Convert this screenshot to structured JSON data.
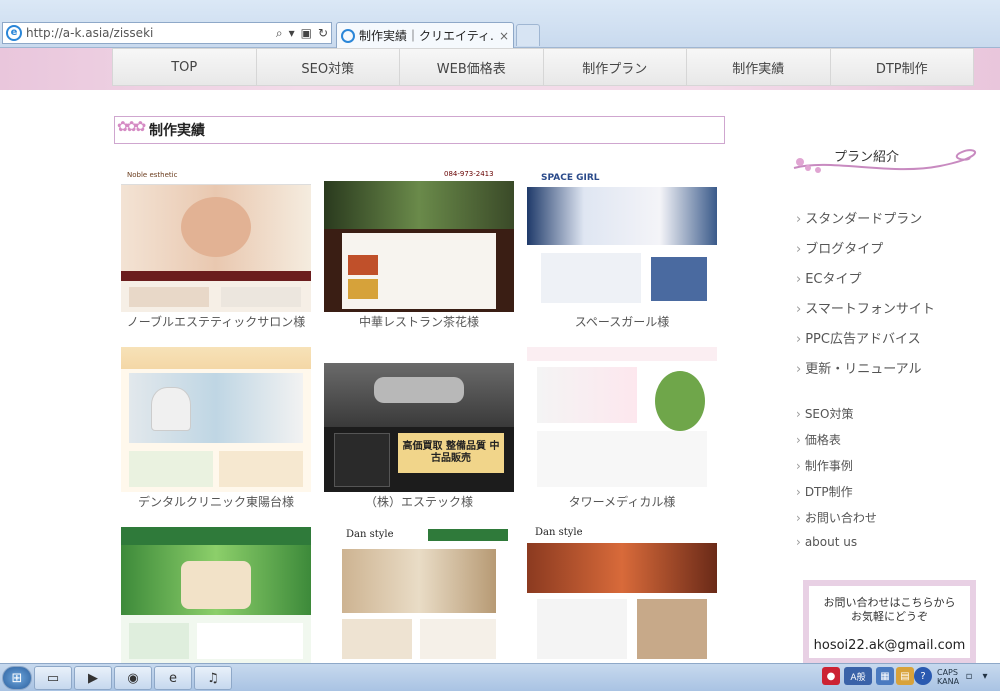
{
  "browser": {
    "address_url": "http://a-k.asia/zisseki",
    "tab_title": "制作実績｜クリエイティ...",
    "tab_close": "×"
  },
  "nav": {
    "items": [
      "TOP",
      "SEO対策",
      "WEB価格表",
      "制作プラン",
      "制作実績",
      "DTP制作"
    ]
  },
  "page": {
    "heading": "制作実績"
  },
  "works": [
    {
      "caption": "ノーブルエステティックサロン様",
      "thumb_text": "Noble esthetic"
    },
    {
      "caption": "中華レストラン茶花様",
      "thumb_text": "084-973-2413"
    },
    {
      "caption": "スペースガール様",
      "thumb_text": "SPACE GIRL"
    },
    {
      "caption": "デンタルクリニック東陽台様",
      "thumb_text": ""
    },
    {
      "caption": "（株）エステック様",
      "thumb_text": "高価買取 整備品質 中古品販売"
    },
    {
      "caption": "タワーメディカル様",
      "thumb_text": ""
    },
    {
      "caption": "",
      "thumb_text": ""
    },
    {
      "caption": "",
      "thumb_text": "Dan style"
    },
    {
      "caption": "",
      "thumb_text": "Dan style"
    }
  ],
  "sidebar": {
    "plan_title": "プラン紹介",
    "plans": [
      "スタンダードプラン",
      "ブログタイプ",
      "ECタイプ",
      "スマートフォンサイト",
      "PPC広告アドバイス",
      "更新・リニューアル"
    ],
    "links": [
      "SEO対策",
      "価格表",
      "制作事例",
      "DTP制作",
      "お問い合わせ",
      "about us"
    ],
    "contact_line1": "お問い合わせはこちらから",
    "contact_line2": "お気軽にどうぞ",
    "contact_email": "hosoi22.ak@gmail.com"
  },
  "taskbar": {
    "caps": "CAPS",
    "kana": "KANA",
    "ime": "A般"
  },
  "colors": {
    "nav_band": "#f3dbe9",
    "heading_border": "#cfa6cf",
    "accent_pink": "#d58bc4"
  }
}
